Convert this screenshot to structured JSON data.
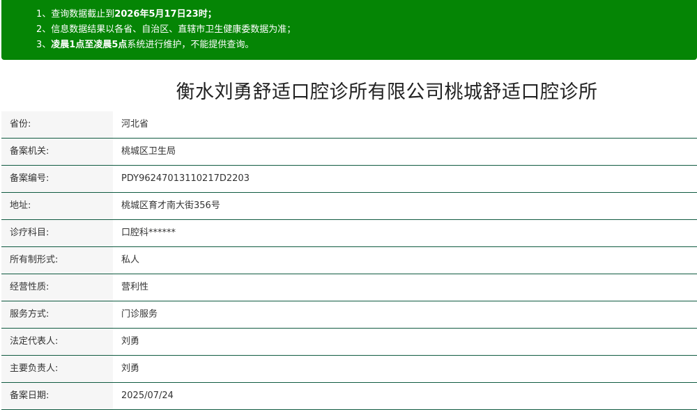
{
  "notice": {
    "line1_prefix": "1、查询数据截止到",
    "line1_highlight": "2026年5月17日23时",
    "line1_suffix": "；",
    "line2": "2、信息数据结果以各省、自治区、直辖市卫生健康委数据为准；",
    "line3_prefix": "3、",
    "line3_highlight": "凌晨1点至凌晨5点",
    "line3_suffix": "系统进行维护，不能提供查询。",
    "background_color": "#058505"
  },
  "title": "衡水刘勇舒适口腔诊所有限公司桃城舒适口腔诊所",
  "fields": [
    {
      "label": "省份:",
      "value": "河北省"
    },
    {
      "label": "备案机关:",
      "value": "桃城区卫生局"
    },
    {
      "label": "备案编号:",
      "value": "PDY96247013110217D2203"
    },
    {
      "label": "地址:",
      "value": "桃城区育才南大街356号"
    },
    {
      "label": "诊疗科目:",
      "value": "口腔科******"
    },
    {
      "label": "所有制形式:",
      "value": "私人"
    },
    {
      "label": "经营性质:",
      "value": "营利性"
    },
    {
      "label": "服务方式:",
      "value": "门诊服务"
    },
    {
      "label": "法定代表人:",
      "value": "刘勇"
    },
    {
      "label": "主要负责人:",
      "value": "刘勇"
    },
    {
      "label": "备案日期:",
      "value": "2025/07/24"
    }
  ]
}
